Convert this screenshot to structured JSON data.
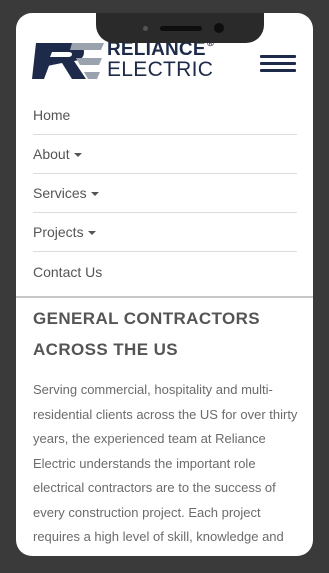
{
  "brand": {
    "name_line1": "RELIANCE",
    "registered": "®",
    "name_line2": "ELECTRIC",
    "color": "#1e2a4a",
    "accent": "#9aa3ad"
  },
  "nav": {
    "items": [
      {
        "label": "Home",
        "has_dropdown": false
      },
      {
        "label": "About",
        "has_dropdown": true
      },
      {
        "label": "Services",
        "has_dropdown": true
      },
      {
        "label": "Projects",
        "has_dropdown": true
      },
      {
        "label": "Contact Us",
        "has_dropdown": false
      }
    ]
  },
  "main": {
    "headline": "GENERAL CONTRACTORS ACROSS THE US",
    "body": "Serving commercial, hospitality and multi-residential clients across the US for over thirty years, the experienced team at Reliance Electric understands the important role electrical contractors are to the success of every construction project. Each project requires a high level of skill, knowledge and work ethic from every"
  }
}
